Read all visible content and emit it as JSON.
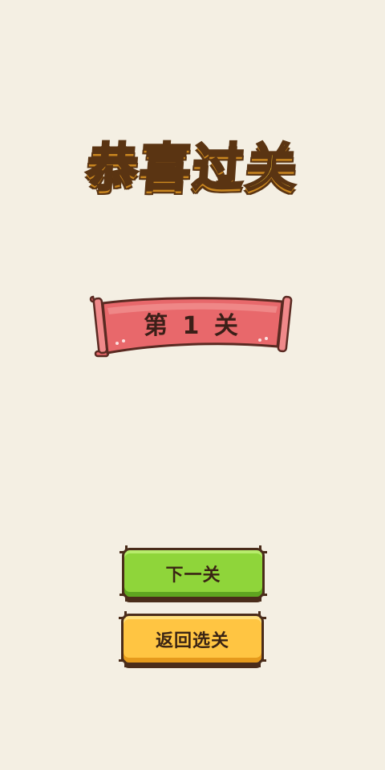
{
  "title": "恭喜过关",
  "level_banner": {
    "label": "第 1 关"
  },
  "buttons": {
    "next_label": "下一关",
    "back_label": "返回选关"
  },
  "colors": {
    "background": "#f4efe3",
    "title_fill": "#ffd23a",
    "ribbon": "#e8686b",
    "next_button": "#8fd53a",
    "back_button": "#ffc542",
    "outline": "#4a2c1a"
  },
  "icons": [
    "scroll-ribbon"
  ]
}
